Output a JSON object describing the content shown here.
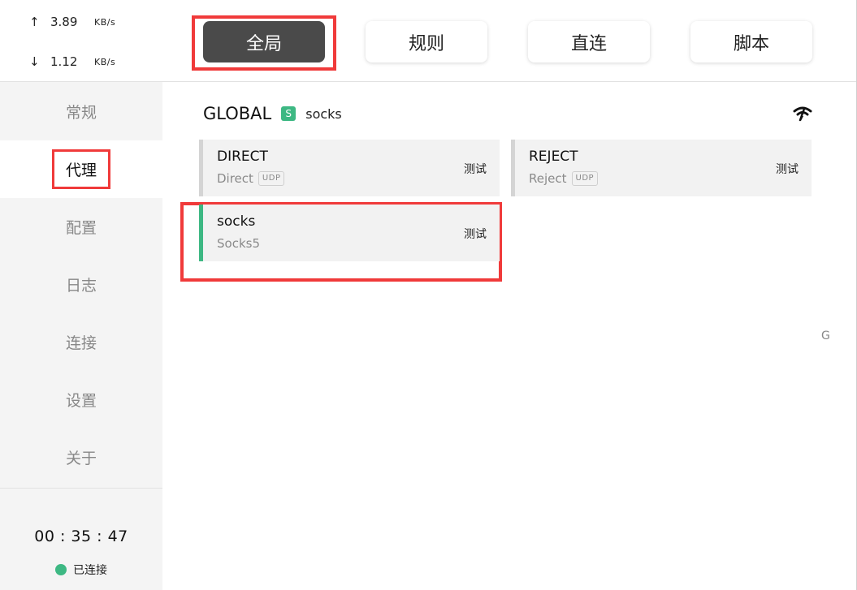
{
  "traffic": {
    "upload": {
      "arrow": "↑",
      "value": "3.89",
      "unit": "KB/s"
    },
    "download": {
      "arrow": "↓",
      "value": "1.12",
      "unit": "KB/s"
    }
  },
  "sidebar": {
    "items": [
      {
        "label": "常规"
      },
      {
        "label": "代理"
      },
      {
        "label": "配置"
      },
      {
        "label": "日志"
      },
      {
        "label": "连接"
      },
      {
        "label": "设置"
      },
      {
        "label": "关于"
      }
    ],
    "active_index": 1
  },
  "footer": {
    "uptime": "00 : 35 : 47",
    "status_text": "已连接",
    "status_color": "#3db883"
  },
  "modes": [
    {
      "label": "全局",
      "active": true
    },
    {
      "label": "规则",
      "active": false
    },
    {
      "label": "直连",
      "active": false
    },
    {
      "label": "脚本",
      "active": false
    }
  ],
  "group": {
    "name": "GLOBAL",
    "badge": "S",
    "selected": "socks",
    "icon": "wifi-signal-icon"
  },
  "proxies": [
    {
      "name": "DIRECT",
      "type": "Direct",
      "udp": "UDP",
      "test_label": "测试",
      "selected": false
    },
    {
      "name": "REJECT",
      "type": "Reject",
      "udp": "UDP",
      "test_label": "测试",
      "selected": false
    },
    {
      "name": "socks",
      "type": "Socks5",
      "udp": "",
      "test_label": "测试",
      "selected": true
    }
  ],
  "edge_letter": "G",
  "colors": {
    "accent": "#3db883",
    "highlight": "#f03a3a",
    "active_mode": "#4a4a4a"
  }
}
